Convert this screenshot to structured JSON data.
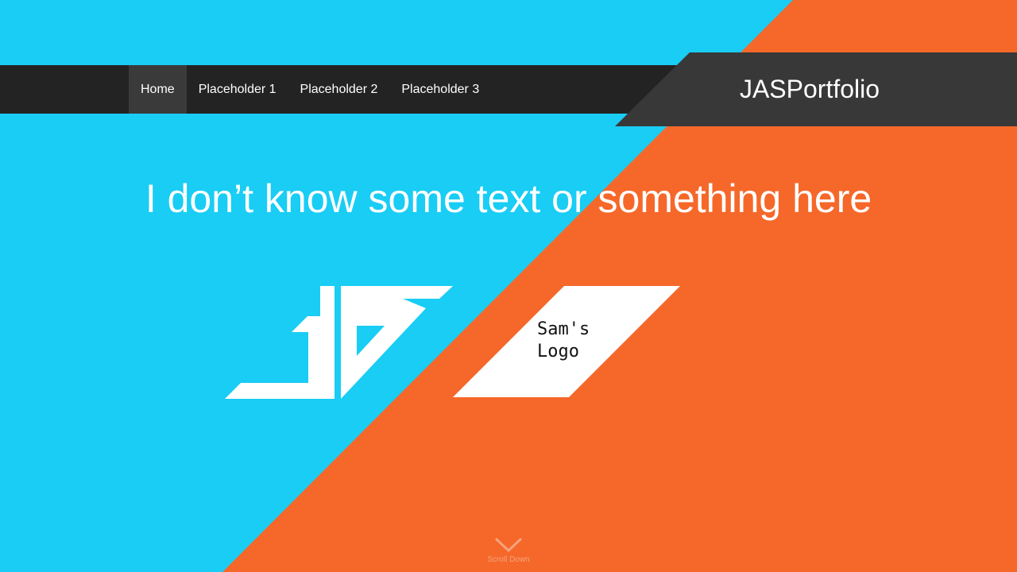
{
  "nav": {
    "items": [
      {
        "label": "Home",
        "active": true
      },
      {
        "label": "Placeholder 1",
        "active": false
      },
      {
        "label": "Placeholder 2",
        "active": false
      },
      {
        "label": "Placeholder 3",
        "active": false
      }
    ]
  },
  "brand": {
    "title": "JASPortfolio"
  },
  "hero": {
    "text": "I don’t know some text or something here"
  },
  "logos": {
    "js_logo": "JS",
    "sam_logo_label": "Sam's\nLogo"
  },
  "scroll": {
    "label": "Scroll Down",
    "icon": "chevron-down-icon"
  },
  "colors": {
    "cyan": "#19cdf4",
    "orange": "#f5682a",
    "navbar": "#232323",
    "nav_active": "#3a3a3a",
    "brand_panel": "#383838",
    "white": "#ffffff"
  }
}
